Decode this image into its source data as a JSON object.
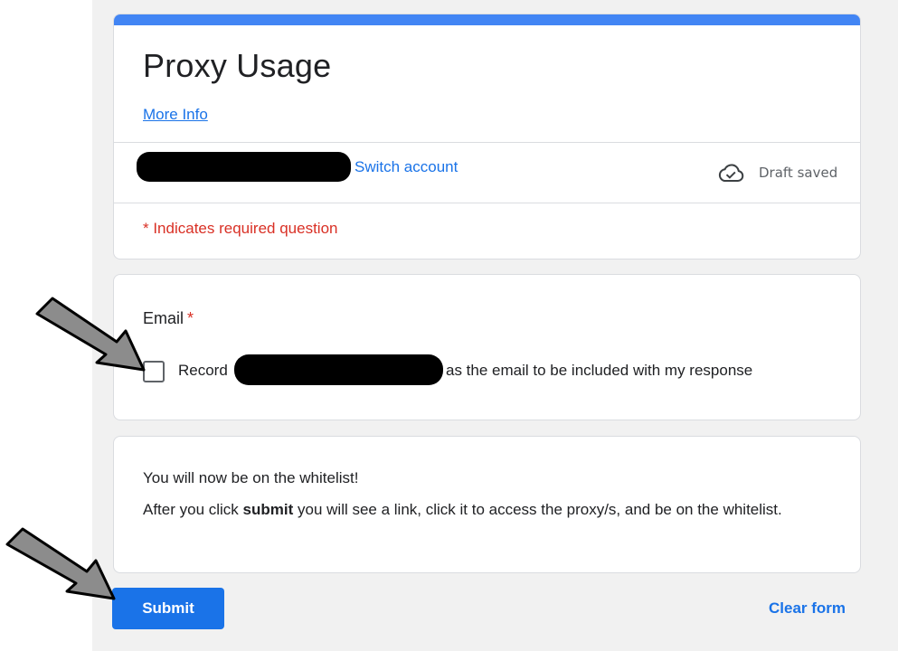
{
  "form": {
    "title": "Proxy Usage",
    "more_info_label": "More Info",
    "accent_color": "#4285f4"
  },
  "account": {
    "switch_label": "Switch account",
    "status_text": "Draft saved",
    "status_icon": "cloud-check-icon"
  },
  "required_note": "* Indicates required question",
  "email_question": {
    "label": "Email",
    "required_mark": "*",
    "record_prefix": "Record",
    "record_suffix": "as the email to be included with my response",
    "checked": false
  },
  "info": {
    "title": "You will now be on the whitelist!",
    "body_prefix": "After you click ",
    "body_bold": "submit",
    "body_suffix": " you will see a link, click it to access the proxy/s, and be on the whitelist."
  },
  "actions": {
    "submit_label": "Submit",
    "clear_label": "Clear form"
  },
  "annotations": {
    "arrow_color": "#8c8c8c"
  }
}
